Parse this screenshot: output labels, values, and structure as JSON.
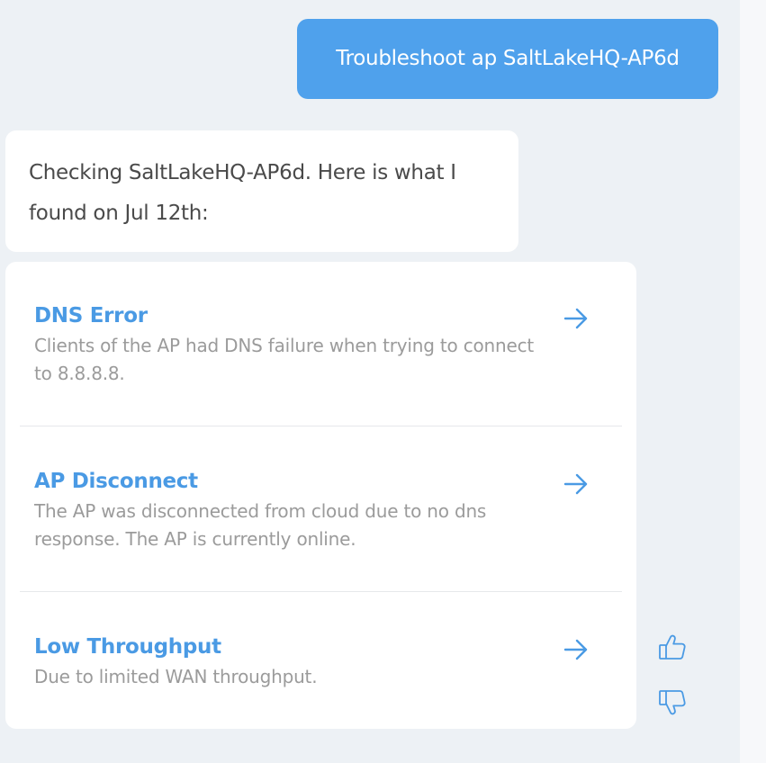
{
  "conversation": {
    "user_message": "Troubleshoot ap SaltLakeHQ-AP6d",
    "bot_message": "Checking SaltLakeHQ-AP6d. Here is what I found on Jul 12th:",
    "results": [
      {
        "title": "DNS Error",
        "description": "Clients of the AP had DNS failure when trying to connect to 8.8.8.8.",
        "icon": "arrow-right-icon"
      },
      {
        "title": "AP Disconnect",
        "description": "The AP was disconnected from cloud due to no dns response. The AP is currently online.",
        "icon": "arrow-right-icon"
      },
      {
        "title": "Low Throughput",
        "description": "Due to limited WAN throughput.",
        "icon": "arrow-right-icon"
      }
    ]
  },
  "feedback": {
    "thumbs_up_icon": "thumbs-up-icon",
    "thumbs_down_icon": "thumbs-down-icon"
  },
  "colors": {
    "accent": "#4a9ae4",
    "user_bubble": "#4fa1ec",
    "background": "#edf1f5",
    "body_text": "#4a4a4a",
    "muted_text": "#9b9b9b"
  }
}
